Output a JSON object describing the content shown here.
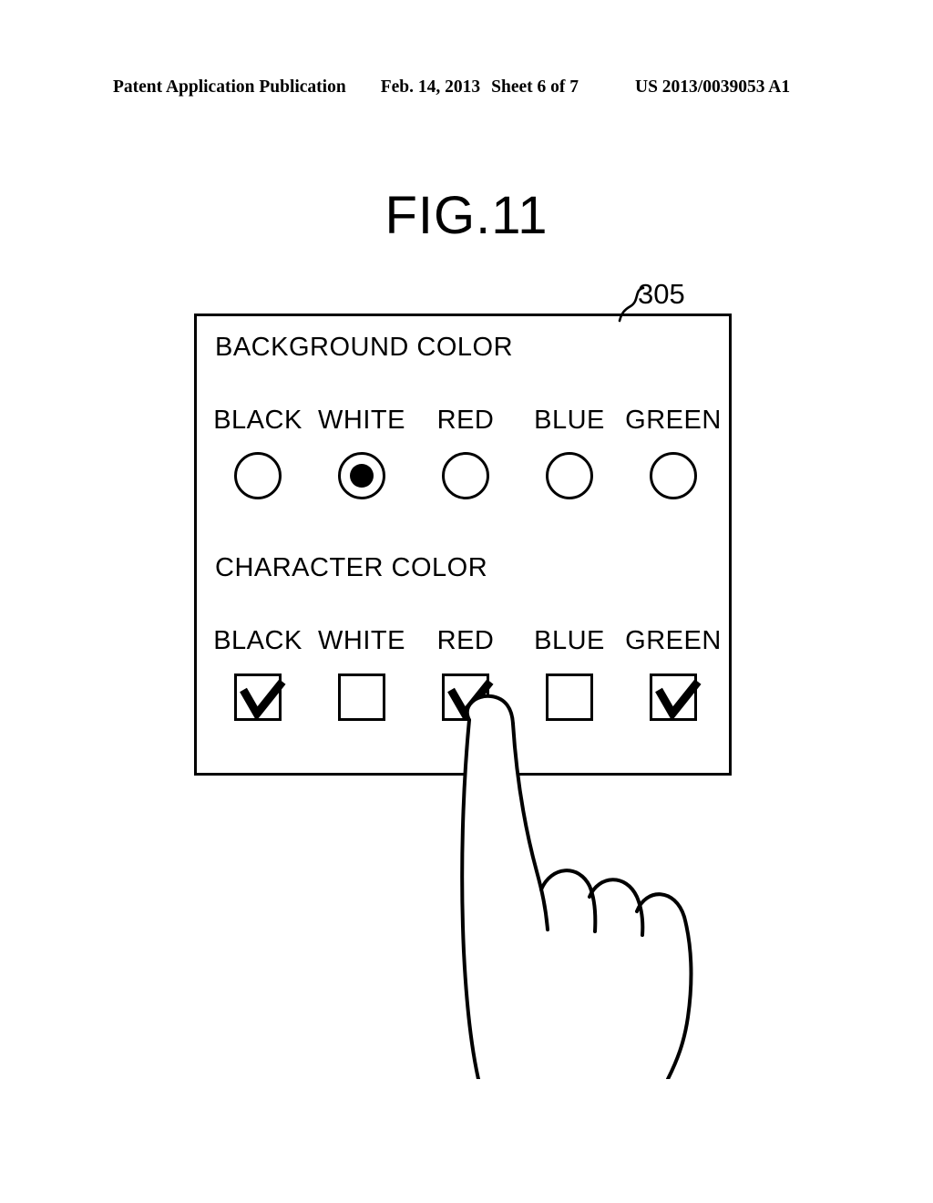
{
  "header": {
    "publication": "Patent Application Publication",
    "date": "Feb. 14, 2013",
    "sheet": "Sheet 6 of 7",
    "number": "US 2013/0039053 A1"
  },
  "figure": {
    "title": "FIG.11",
    "reference_numeral": "305"
  },
  "panel": {
    "sections": [
      {
        "heading": "BACKGROUND COLOR",
        "control_type": "radio",
        "options": [
          {
            "label": "BLACK",
            "selected": false
          },
          {
            "label": "WHITE",
            "selected": true
          },
          {
            "label": "RED",
            "selected": false
          },
          {
            "label": "BLUE",
            "selected": false
          },
          {
            "label": "GREEN",
            "selected": false
          }
        ]
      },
      {
        "heading": "CHARACTER COLOR",
        "control_type": "checkbox",
        "options": [
          {
            "label": "BLACK",
            "checked": true
          },
          {
            "label": "WHITE",
            "checked": false
          },
          {
            "label": "RED",
            "checked": true
          },
          {
            "label": "BLUE",
            "checked": false
          },
          {
            "label": "GREEN",
            "checked": true
          }
        ]
      }
    ]
  },
  "annotation": {
    "hand": "pointing-hand-touching-red-character-color-checkbox"
  },
  "colors": {
    "line": "#000000",
    "background": "#ffffff"
  }
}
